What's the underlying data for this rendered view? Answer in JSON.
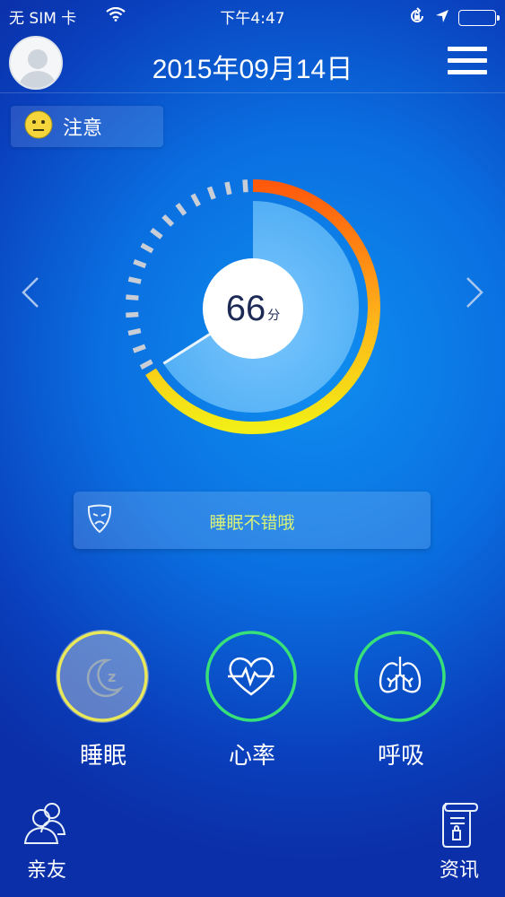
{
  "status_bar": {
    "carrier": "无 SIM 卡",
    "time": "下午4:47"
  },
  "header": {
    "date": "2015年09月14日"
  },
  "status_badge": {
    "label": "注意"
  },
  "score": {
    "value": "66",
    "unit": "分",
    "fraction": 0.66
  },
  "message": {
    "text": "睡眠不错哦"
  },
  "metrics": [
    {
      "label": "睡眠",
      "icon": "moon-sleep-icon",
      "ring_color": "#e8e85a",
      "active": true
    },
    {
      "label": "心率",
      "icon": "heartbeat-icon",
      "ring_color": "#38e07a",
      "active": false
    },
    {
      "label": "呼吸",
      "icon": "lungs-icon",
      "ring_color": "#38e07a",
      "active": false
    }
  ],
  "bottom_nav": {
    "friends": "亲友",
    "news": "资讯"
  },
  "colors": {
    "gauge_orange": "#ff6a10",
    "gauge_yellow": "#f2ee16",
    "gauge_track": "#c9ced6",
    "message_text": "#d8f27a"
  }
}
